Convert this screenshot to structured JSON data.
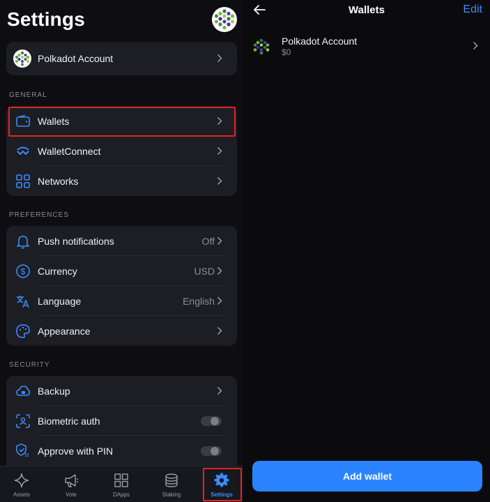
{
  "settings": {
    "title": "Settings",
    "account_label": "Polkadot Account",
    "general": {
      "header": "GENERAL",
      "items": [
        {
          "label": "Wallets"
        },
        {
          "label": "WalletConnect"
        },
        {
          "label": "Networks"
        }
      ]
    },
    "preferences": {
      "header": "PREFERENCES",
      "items": [
        {
          "label": "Push notifications",
          "value": "Off"
        },
        {
          "label": "Currency",
          "value": "USD"
        },
        {
          "label": "Language",
          "value": "English"
        },
        {
          "label": "Appearance"
        }
      ]
    },
    "security": {
      "header": "SECURITY",
      "items": [
        {
          "label": "Backup"
        },
        {
          "label": "Biometric auth",
          "toggle": false
        },
        {
          "label": "Approve with PIN",
          "toggle": false
        }
      ]
    }
  },
  "tabbar": {
    "tabs": [
      {
        "label": "Assets",
        "icon": "sparkle-icon"
      },
      {
        "label": "Vote",
        "icon": "megaphone-icon"
      },
      {
        "label": "DApps",
        "icon": "grid-icon"
      },
      {
        "label": "Staking",
        "icon": "database-icon"
      },
      {
        "label": "Settings",
        "icon": "gear-icon",
        "active": true
      }
    ]
  },
  "wallets_screen": {
    "title": "Wallets",
    "edit_label": "Edit",
    "wallet": {
      "name": "Polkadot Account",
      "balance": "$0"
    },
    "add_button": "Add wallet"
  },
  "colors": {
    "accent": "#2a84ff",
    "highlight": "#e02424",
    "card": "#1d1e24"
  }
}
